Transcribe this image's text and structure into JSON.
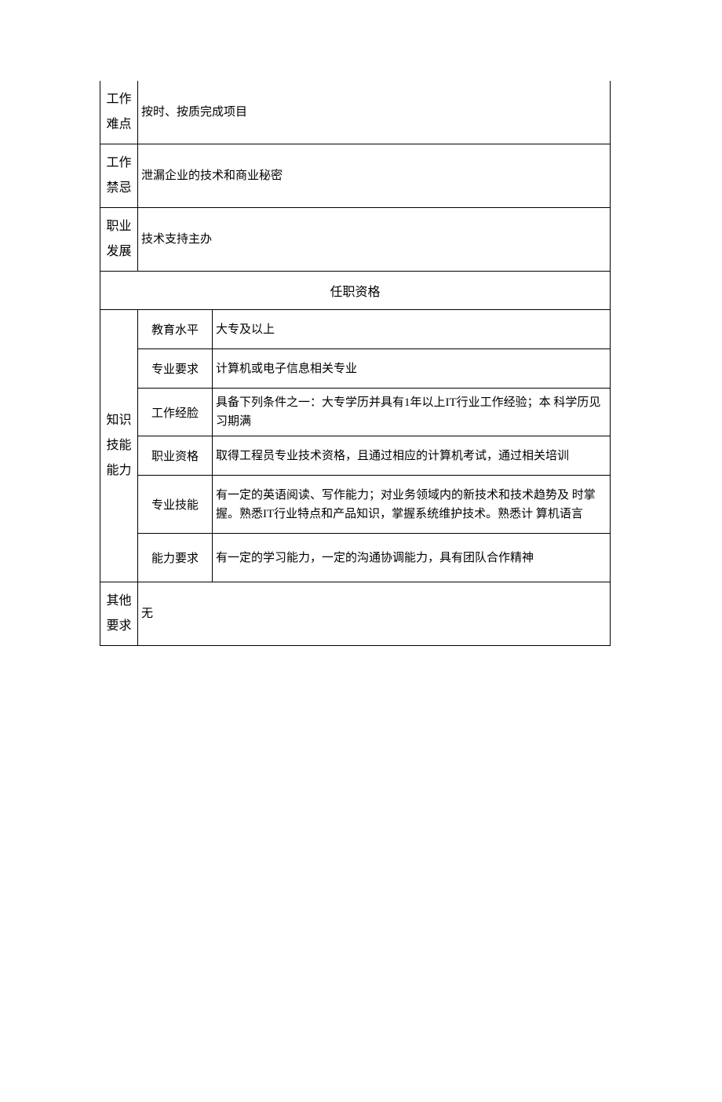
{
  "rows": {
    "difficulty": {
      "label": "工作难点",
      "value": "按时、按质完成项目"
    },
    "taboo": {
      "label": "工作禁忌",
      "value": "泄漏企业的技术和商业秘密"
    },
    "career": {
      "label": "职业发展",
      "value": "技术支持主办"
    },
    "section": {
      "title": "任职资格"
    },
    "knowledge": {
      "label": "知识技能能力",
      "items": [
        {
          "name": "教育水平",
          "value": "大专及以上"
        },
        {
          "name": "专业要求",
          "value": "计算机或电子信息相关专业"
        },
        {
          "name": "工作经脸",
          "value": "具备下列条件之一：大专学历并具有1年以上IT行业工作经验；本 科学历见习期满"
        },
        {
          "name": "职业资格",
          "value": "取得工程员专业技术资格，且通过相应的计算机考试，通过相关培训"
        },
        {
          "name": "专业技能",
          "value": "有一定的英语阅读、写作能力；对业务领域内的新技术和技术趋势及 时掌握。熟悉IT行业特点和产品知识，掌握系统维护技术。熟悉计 算机语言"
        },
        {
          "name": "能力要求",
          "value": "有一定的学习能力，一定的沟通协调能力，具有团队合作精神"
        }
      ]
    },
    "other": {
      "label": "其他要求",
      "value": "无"
    }
  }
}
